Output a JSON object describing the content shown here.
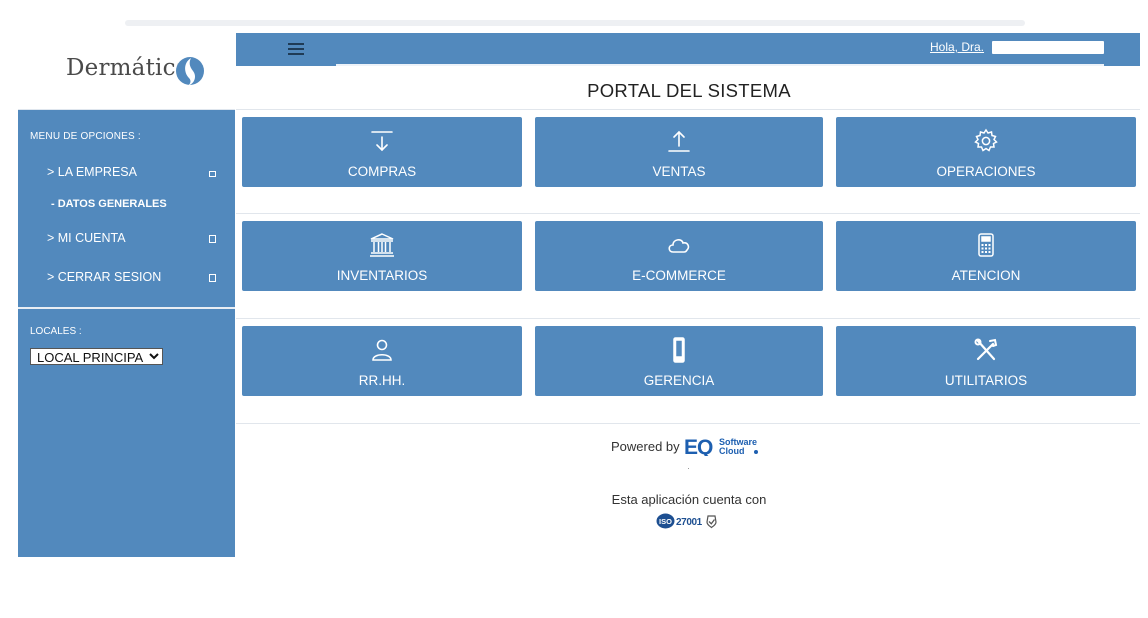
{
  "brand": {
    "logo_text": "Dermática"
  },
  "sidebar": {
    "menu_title": "MENU DE OPCIONES :",
    "items": [
      {
        "label": "> LA EMPRESA"
      },
      {
        "label": "- DATOS GENERALES"
      },
      {
        "label": "> MI CUENTA"
      },
      {
        "label": "> CERRAR SESION"
      }
    ],
    "locales_label": "LOCALES :",
    "locales_selected": "LOCAL PRINCIPAL"
  },
  "header": {
    "greeting": "Hola, Dra."
  },
  "main": {
    "title": "PORTAL DEL SISTEMA",
    "tiles": [
      {
        "label": "COMPRAS",
        "icon": "download-arrow-icon"
      },
      {
        "label": "VENTAS",
        "icon": "upload-arrow-icon"
      },
      {
        "label": "OPERACIONES",
        "icon": "gear-icon"
      },
      {
        "label": "INVENTARIOS",
        "icon": "bank-icon"
      },
      {
        "label": "E-COMMERCE",
        "icon": "cloud-icon"
      },
      {
        "label": "ATENCION",
        "icon": "calculator-icon"
      },
      {
        "label": "RR.HH.",
        "icon": "user-icon"
      },
      {
        "label": "GERENCIA",
        "icon": "mobile-phone-icon"
      },
      {
        "label": "UTILITARIOS",
        "icon": "tools-icon"
      }
    ]
  },
  "footer": {
    "powered_by": "Powered by",
    "eq_letters": "EQ",
    "eq_software": "Software",
    "eq_cloud": "Cloud",
    "iso_text": "Esta aplicación cuenta con",
    "iso_badge": "ISO",
    "iso_number": "27001"
  },
  "colors": {
    "primary": "#5289bd",
    "background": "#ffffff",
    "text": "#222222"
  }
}
